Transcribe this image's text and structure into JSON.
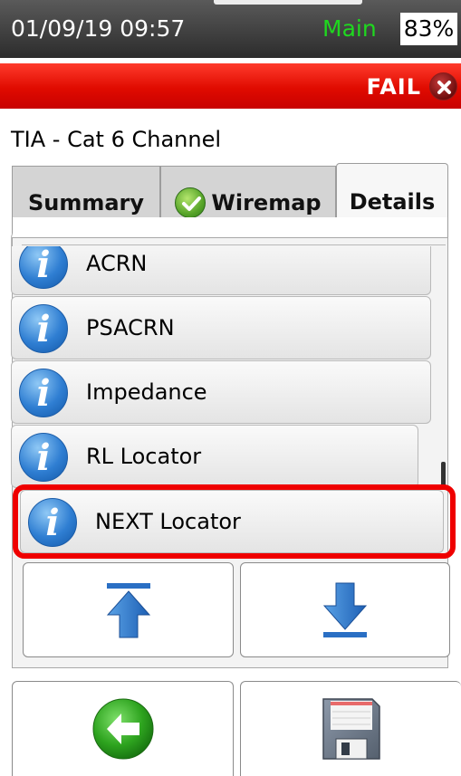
{
  "status_bar": {
    "datetime": "01/09/19 09:57",
    "mode": "Main",
    "battery": "83%"
  },
  "result_banner": {
    "text": "FAIL",
    "icon": "fail-x-icon",
    "color": "#e00b00"
  },
  "test_title": "TIA - Cat 6 Channel",
  "tabs": [
    {
      "label": "Summary",
      "selected": false
    },
    {
      "label": "Wiremap",
      "icon": "pass-check-icon",
      "selected": false
    },
    {
      "label": "Details",
      "selected": true
    }
  ],
  "details_list": [
    {
      "label": "ACRN",
      "icon": "info-icon"
    },
    {
      "label": "PSACRN",
      "icon": "info-icon"
    },
    {
      "label": "Impedance",
      "icon": "info-icon"
    },
    {
      "label": "RL Locator",
      "icon": "info-icon"
    },
    {
      "label": "NEXT Locator",
      "icon": "info-icon",
      "highlighted": true
    }
  ],
  "buttons": {
    "scroll_top": "scroll-to-top-icon",
    "scroll_bottom": "scroll-to-bottom-icon",
    "back": "back-arrow-icon",
    "save": "floppy-disk-icon"
  },
  "colors": {
    "highlight": "#ef0000",
    "mode_text": "#1fd81f"
  }
}
